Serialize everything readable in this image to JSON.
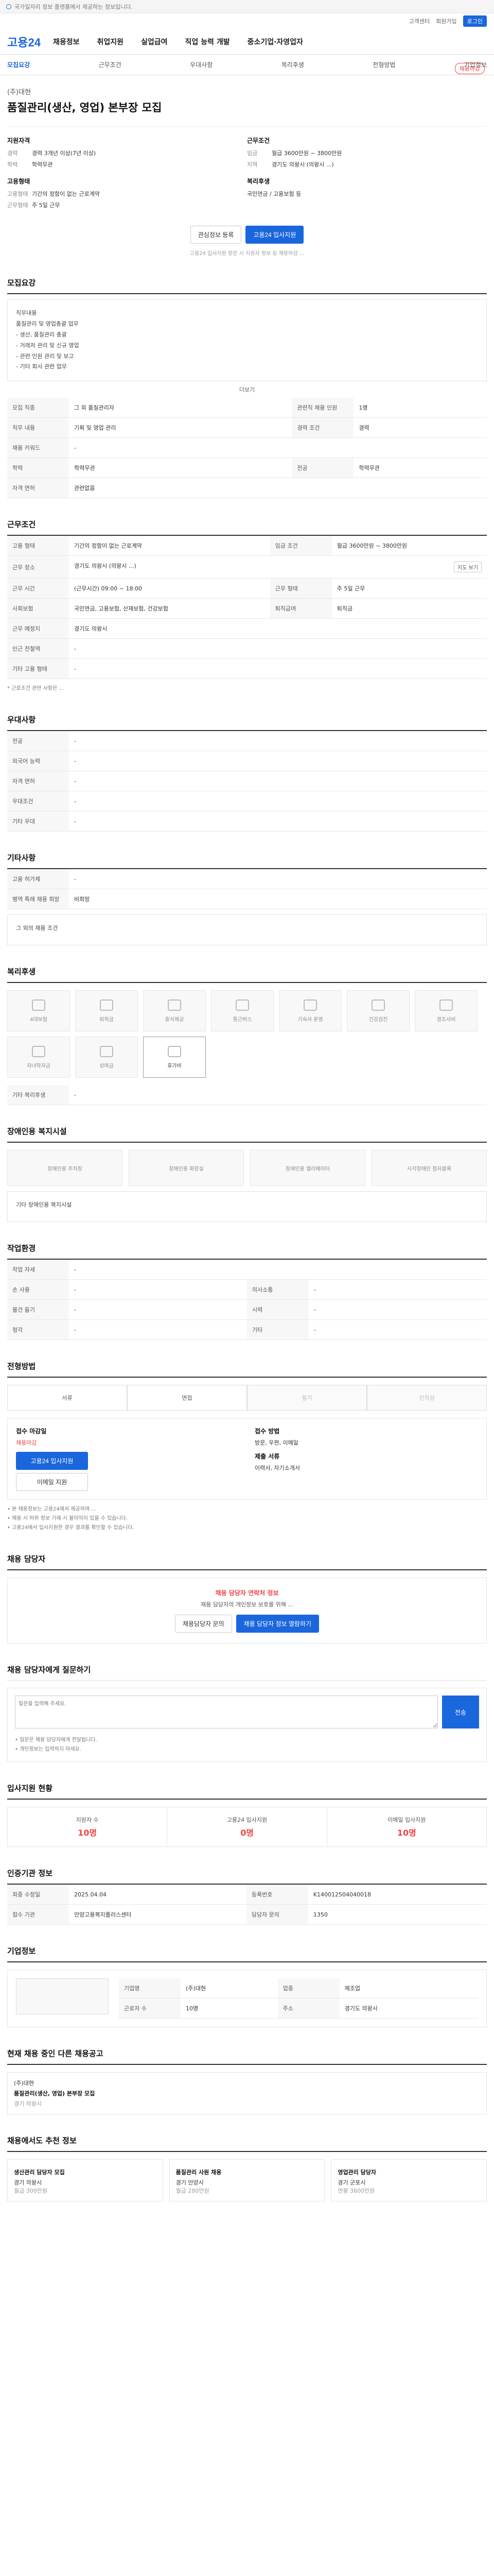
{
  "topbar": {
    "text": "국가일자리 정보 플랫폼에서 제공하는 정보입니다."
  },
  "util": {
    "items": [
      "로그인",
      "회원가입",
      "고객센터"
    ]
  },
  "brand": {
    "name": "고용24"
  },
  "gnb": {
    "items": [
      "채용정보",
      "취업지원",
      "실업급여",
      "직업 능력 개발",
      "중소기업·자영업자"
    ]
  },
  "subnav": {
    "items": [
      "모집요강",
      "근무조건",
      "우대사항",
      "복리후생",
      "전형방법",
      "기업정보"
    ]
  },
  "job": {
    "company": "(주)대현",
    "title": "품질관리(생산, 영업) 본부장 모집",
    "badge": "채용마감",
    "left_head": "지원자격",
    "left": [
      {
        "k": "경력",
        "v": "경력 3개년 이상(7년 이상)"
      },
      {
        "k": "학력",
        "v": "학력무관"
      }
    ],
    "right_head": "근무조건",
    "right": [
      {
        "k": "임금",
        "v": "월급 3600만원 ~ 3800만원"
      },
      {
        "k": "지역",
        "v": "경기도 의왕시 (의왕시 ...)"
      }
    ],
    "left2_head": "고용형태",
    "left2": [
      {
        "k": "고용형태",
        "v": "기간의 정함이 없는 근로계약"
      },
      {
        "k": "근무형태",
        "v": "주 5일 근무"
      }
    ],
    "right2_head": "복리후생",
    "right2": [
      {
        "k": "",
        "v": "국민연금 / 고용보험 등"
      }
    ],
    "actions": [
      "관심정보 등록",
      "고용24 입사지원"
    ],
    "note": "고용24 입사지원 방문 시 지원자 정보 등 채용마감 ..."
  },
  "sec_recruit": {
    "title": "모집요강",
    "desc_lines": [
      "직무내용",
      "품질관리 및 영업총괄 업무",
      "- 생산, 품질관리 총괄",
      "- 거래처 관리 및 신규 영업",
      "- 관련 인원 관리 및 보고",
      "- 기타 회사 관련 업무"
    ],
    "more": "더보기",
    "rows": [
      {
        "k": "모집 직종",
        "v": "그 외 품질관리자",
        "k2": "관련직 채용 인원",
        "v2": "1명"
      },
      {
        "k": "직무 내용",
        "v": "기획 및 영업 관리",
        "k2": "경력 조건",
        "v2": "경력"
      },
      {
        "k": "채용 키워드",
        "v": "-",
        "k2": "",
        "v2": ""
      },
      {
        "k": "학력",
        "v": "학력무관",
        "k2": "전공",
        "v2": "학력무관"
      },
      {
        "k": "자격 면허",
        "v": "관련없음",
        "k2": "",
        "v2": ""
      }
    ]
  },
  "sec_work": {
    "title": "근무조건",
    "rows": [
      {
        "k": "고용 형태",
        "v": "기간의 정함이 없는 근로계약",
        "k2": "임금 조건",
        "v2": "월급 3600만원 ~ 3800만원"
      },
      {
        "k": "근무 장소",
        "v": "경기도 의왕시 (의왕시 ...)",
        "k2": "",
        "v2": ""
      },
      {
        "k": "근무 시간",
        "v": "(근무시간) 09:00 ~ 18:00",
        "k2": "근무 형태",
        "v2": "주 5일 근무"
      },
      {
        "k": "사회보험",
        "v": "국민연금, 고용보험, 산재보험, 건강보험",
        "k2": "퇴직급여",
        "v2": "퇴직금"
      },
      {
        "k": "근무 예정지",
        "v": "경기도 의왕시",
        "k2": "",
        "v2": ""
      },
      {
        "k": "인근 전철역",
        "v": "-",
        "k2": "",
        "v2": ""
      },
      {
        "k": "기타 고용 형태",
        "v": "-",
        "k2": "",
        "v2": ""
      }
    ],
    "map_btn": "지도 보기",
    "foot": "* 근로조건 관련 사항은 ..."
  },
  "sec_pref": {
    "title": "우대사항",
    "rows": [
      {
        "k": "전공",
        "v": "-"
      },
      {
        "k": "외국어 능력",
        "v": "-"
      },
      {
        "k": "자격 면허",
        "v": "-"
      },
      {
        "k": "우대조건",
        "v": "-"
      },
      {
        "k": "기타 우대",
        "v": "-"
      }
    ]
  },
  "sec_etc": {
    "title": "기타사항",
    "rows": [
      {
        "k": "고용 허가제",
        "v": "-"
      },
      {
        "k": "병역 특례 채용 희망",
        "v": "비희망"
      }
    ],
    "extra": "그 외의 채용 조건"
  },
  "sec_welfare": {
    "title": "복리후생",
    "items": [
      {
        "label": "4대보험",
        "on": false
      },
      {
        "label": "퇴직금",
        "on": false
      },
      {
        "label": "중식제공",
        "on": false
      },
      {
        "label": "통근버스",
        "on": false
      },
      {
        "label": "기숙사 운영",
        "on": false
      },
      {
        "label": "건강검진",
        "on": false
      },
      {
        "label": "경조사비",
        "on": false
      },
      {
        "label": "자녀학자금",
        "on": false
      },
      {
        "label": "상여금",
        "on": false
      },
      {
        "label": "휴가비",
        "on": true
      }
    ],
    "extra_head": "기타 복리후생",
    "extra_val": "-"
  },
  "sec_disab": {
    "title": "장애인용 복지시설",
    "items": [
      "장애인용 주차장",
      "장애인용 화장실",
      "장애인용 엘리베이터",
      "시각장애인 점자블록"
    ],
    "extra": "기타 장애인용 복지시설"
  },
  "sec_env": {
    "title": "작업환경",
    "rows": [
      {
        "k": "작업 자세",
        "v": "-",
        "k2": "",
        "v2": ""
      },
      {
        "k": "손 사용",
        "v": "-",
        "k2": "의사소통",
        "v2": "-"
      },
      {
        "k": "물건 들기",
        "v": "-",
        "k2": "시력",
        "v2": "-"
      },
      {
        "k": "청각",
        "v": "-",
        "k2": "기타",
        "v2": "-"
      }
    ]
  },
  "sec_select": {
    "title": "전형방법",
    "steps": [
      {
        "label": "서류",
        "off": false
      },
      {
        "label": "면접",
        "off": false
      },
      {
        "label": "필기",
        "off": true
      },
      {
        "label": "인적성",
        "off": true
      }
    ],
    "apply_head": "접수 마감일",
    "apply_val": "채용마감",
    "apply_btn1": "고용24 입사지원",
    "apply_btn2": "이메일 지원",
    "doc_head": "접수 방법",
    "doc_val": "방문, 우편, 이메일",
    "doc_head2": "제출 서류",
    "doc_val2": "이력서, 자기소개서",
    "cautions": [
      "• 본 채용정보는 고용24에서 제공하며 ...",
      "• 채용 시 허위 정보 기재 시 불이익이 있을 수 있습니다.",
      "• 고용24에서 입사지원한 경우 결과를 확인할 수 있습니다."
    ]
  },
  "sec_manager": {
    "title": "채용 담당자",
    "alert": "채용 담당자 연락처 정보",
    "desc": "채용 담당자의 개인정보 보호를 위해 ...",
    "btn1": "채용담당자 문의",
    "btn2": "채용 담당자 정보 열람하기"
  },
  "sec_qna": {
    "title": "채용 담당자에게 질문하기",
    "placeholder": "질문을 입력해 주세요.",
    "send": "전송",
    "notes": [
      "• 질문은 채용 담당자에게 전달됩니다.",
      "• 개인정보는 입력하지 마세요."
    ]
  },
  "sec_count": {
    "title": "입사지원 현황",
    "items": [
      {
        "k": "지원자 수",
        "v": "10명"
      },
      {
        "k": "고용24 입사지원",
        "v": "0명"
      },
      {
        "k": "이메일 입사지원",
        "v": "10명"
      }
    ]
  },
  "sec_info": {
    "title": "인증기관 정보",
    "rows": [
      {
        "k": "최종 수정일",
        "v": "2025.04.04",
        "k2": "등록번호",
        "v2": "K140012504040018"
      },
      {
        "k": "접수 기관",
        "v": "안양고용복지플러스센터",
        "k2": "담당자 문의",
        "v2": "1350"
      }
    ]
  },
  "sec_company": {
    "title": "기업정보",
    "name_k": "기업명",
    "name_v": "(주)대현",
    "type_k": "업종",
    "type_v": "제조업",
    "size_k": "근로자 수",
    "size_v": "10명",
    "addr_k": "주소",
    "addr_v": "경기도 의왕시"
  },
  "sec_recs": {
    "title": "현재 채용 중인 다른 채용공고",
    "cards": [
      {
        "t": "품질관리(생산, 영업) 본부장 모집",
        "s": "(주)대현",
        "d": "경기 의왕시"
      }
    ]
  },
  "sec_ai": {
    "title": "채용에서도 추천 정보",
    "cards": [
      {
        "t": "생산관리 담당자 모집",
        "s": "경기 의왕시",
        "d": "월급 300만원"
      },
      {
        "t": "품질관리 사원 채용",
        "s": "경기 안양시",
        "d": "월급 280만원"
      },
      {
        "t": "영업관리 담당자",
        "s": "경기 군포시",
        "d": "연봉 3600만원"
      }
    ]
  }
}
